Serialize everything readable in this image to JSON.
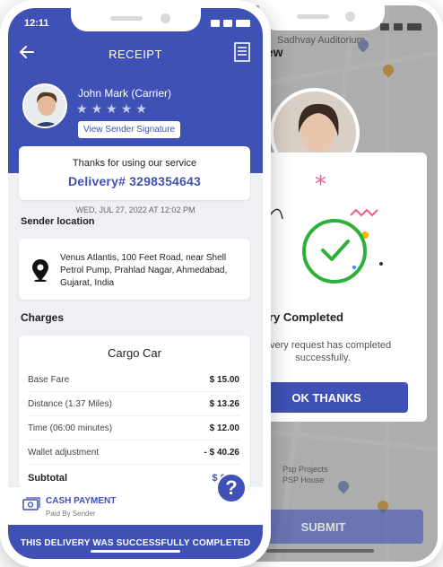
{
  "back_phone": {
    "map_place": "Sadhvay Auditorium",
    "map_place2": "Psp Projects",
    "map_place3": "PSP House",
    "header_partial": "iew",
    "modal": {
      "title_partial": "elivery Completed",
      "message": "delivery request has completed successfully.",
      "ok_label": "OK THANKS"
    },
    "submit_label": "SUBMIT"
  },
  "front_phone": {
    "status_time": "12:11",
    "header_title": "RECEIPT",
    "carrier_name": "John Mark (Carrier)",
    "rating": 5,
    "signature_button": "View Sender Signature",
    "thanks_text": "Thanks for using our service",
    "delivery_number": "Delivery# 3298354643",
    "date_time": "WED, JUL 27, 2022 AT 12:02 PM",
    "sender_location_heading": "Sender location",
    "sender_address": "Venus Atlantis, 100 Feet Road, near Shell Petrol Pump, Prahlad Nagar, Ahmedabad, Gujarat, India",
    "charges_heading": "Charges",
    "vehicle": "Cargo Car",
    "charges": [
      {
        "label": "Base Fare",
        "value": "$ 15.00"
      },
      {
        "label": "Distance (1.37 Miles)",
        "value": "$ 13.26"
      },
      {
        "label": "Time (06:00 minutes)",
        "value": "$ 12.00"
      },
      {
        "label": "Wallet adjustment",
        "value": "- $ 40.26"
      }
    ],
    "subtotal_label": "Subtotal",
    "subtotal_value": "$ 0.00",
    "payment_method": "CASH PAYMENT",
    "payment_by": "Paid By Sender",
    "help_label": "?",
    "banner": "THIS DELIVERY WAS SUCCESSFULLY COMPLETED"
  },
  "colors": {
    "primary": "#3f51b5",
    "success": "#2db03a"
  }
}
